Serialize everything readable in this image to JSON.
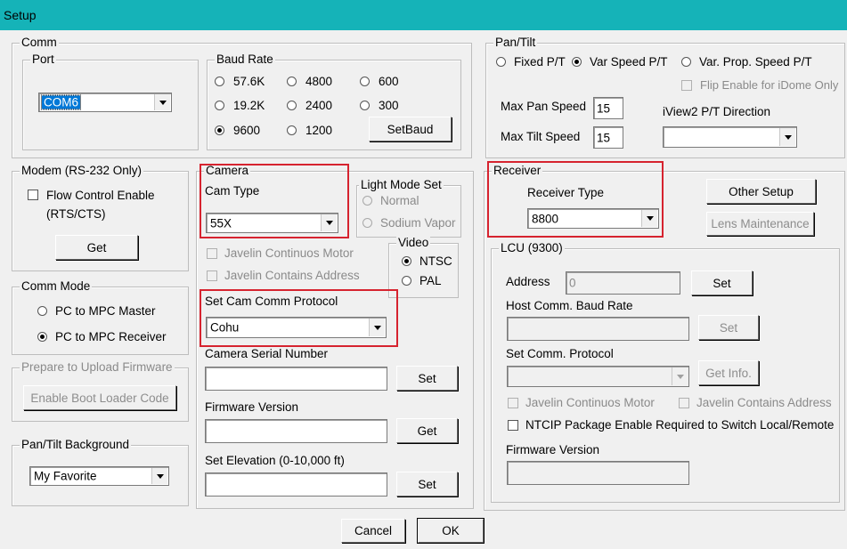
{
  "window": {
    "title": "Setup"
  },
  "comm": {
    "legend": "Comm",
    "port": {
      "legend": "Port",
      "value": "COM6"
    },
    "baud": {
      "legend": "Baud Rate",
      "options": [
        "57.6K",
        "4800",
        "600",
        "19.2K",
        "2400",
        "300",
        "9600",
        "1200"
      ],
      "selected": "9600",
      "set_button": "SetBaud"
    }
  },
  "pan_tilt": {
    "legend": "Pan/Tilt",
    "modes": [
      "Fixed P/T",
      "Var Speed P/T",
      "Var. Prop. Speed P/T"
    ],
    "selected": "Var Speed P/T",
    "flip_enable": "Flip Enable for iDome Only",
    "max_pan_label": "Max Pan Speed",
    "max_pan_value": "15",
    "max_tilt_label": "Max Tilt Speed",
    "max_tilt_value": "15",
    "direction_label": "iView2 P/T Direction",
    "direction_value": ""
  },
  "modem": {
    "legend": "Modem (RS-232 Only)",
    "flow_control_line1": "Flow Control Enable",
    "flow_control_line2": "(RTS/CTS)",
    "get_button": "Get"
  },
  "comm_mode": {
    "legend": "Comm Mode",
    "options": [
      "PC to MPC Master",
      "PC to MPC Receiver"
    ],
    "selected": "PC to MPC Receiver"
  },
  "firmware_upload": {
    "legend": "Prepare to Upload Firmware",
    "button": "Enable Boot Loader Code"
  },
  "pt_background": {
    "legend": "Pan/Tilt Background",
    "value": "My Favorite"
  },
  "camera": {
    "legend": "Camera",
    "cam_type_label": "Cam Type",
    "cam_type_value": "55X",
    "light_mode": {
      "legend": "Light Mode Set",
      "options": [
        "Normal",
        "Sodium Vapor"
      ]
    },
    "javelin_motor": "Javelin Continuos Motor",
    "javelin_address": "Javelin Contains Address",
    "video": {
      "legend": "Video",
      "options": [
        "NTSC",
        "PAL"
      ],
      "selected": "NTSC"
    },
    "protocol_label": "Set Cam Comm Protocol",
    "protocol_value": "Cohu",
    "serial_label": "Camera Serial Number",
    "serial_button": "Set",
    "firmware_label": "Firmware Version",
    "firmware_button": "Get",
    "elevation_label": "Set Elevation (0-10,000 ft)",
    "elevation_button": "Set"
  },
  "receiver": {
    "legend": "Receiver",
    "type_label": "Receiver Type",
    "type_value": "8800",
    "other_setup_button": "Other Setup",
    "lens_button": "Lens Maintenance"
  },
  "lcu": {
    "legend": "LCU (9300)",
    "address_label": "Address",
    "address_value": "0",
    "address_button": "Set",
    "host_baud_label": "Host Comm. Baud Rate",
    "host_baud_button": "Set",
    "protocol_label": "Set Comm. Protocol",
    "get_info_button": "Get Info.",
    "javelin_motor": "Javelin Continuos Motor",
    "javelin_address": "Javelin Contains Address",
    "ntcip": "NTCIP Package Enable Required to Switch Local/Remote",
    "firmware_label": "Firmware Version"
  },
  "footer": {
    "cancel": "Cancel",
    "ok": "OK"
  },
  "colors": {
    "titlebar": "#15b3b8",
    "highlight_border": "#d6232f",
    "selection": "#0078d7"
  }
}
